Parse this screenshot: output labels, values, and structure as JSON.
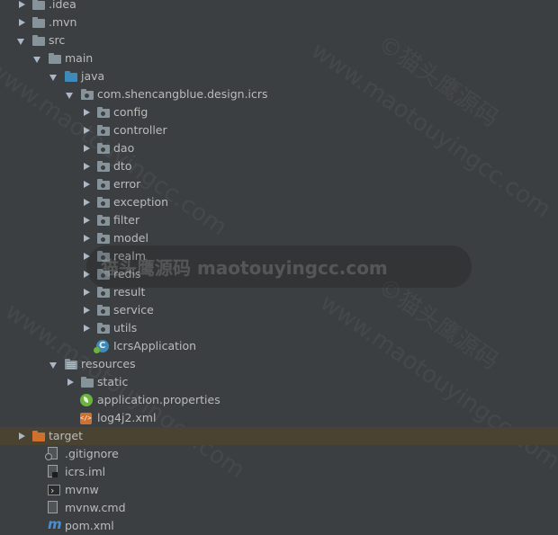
{
  "project_tree": {
    "items": [
      {
        "label": ".idea",
        "indent": 0,
        "arrow": "collapsed",
        "icon": "folder-gray",
        "icon_name": "folder-icon"
      },
      {
        "label": ".mvn",
        "indent": 0,
        "arrow": "collapsed",
        "icon": "folder-gray",
        "icon_name": "folder-icon"
      },
      {
        "label": "src",
        "indent": 0,
        "arrow": "expanded",
        "icon": "folder-gray",
        "icon_name": "folder-icon"
      },
      {
        "label": "main",
        "indent": 1,
        "arrow": "expanded",
        "icon": "folder-gray",
        "icon_name": "folder-icon"
      },
      {
        "label": "java",
        "indent": 2,
        "arrow": "expanded",
        "icon": "folder-blue",
        "icon_name": "source-folder-icon"
      },
      {
        "label": "com.shencangblue.design.icrs",
        "indent": 3,
        "arrow": "expanded",
        "icon": "package",
        "icon_name": "package-icon"
      },
      {
        "label": "config",
        "indent": 4,
        "arrow": "collapsed",
        "icon": "package",
        "icon_name": "package-icon"
      },
      {
        "label": "controller",
        "indent": 4,
        "arrow": "collapsed",
        "icon": "package",
        "icon_name": "package-icon"
      },
      {
        "label": "dao",
        "indent": 4,
        "arrow": "collapsed",
        "icon": "package",
        "icon_name": "package-icon"
      },
      {
        "label": "dto",
        "indent": 4,
        "arrow": "collapsed",
        "icon": "package",
        "icon_name": "package-icon"
      },
      {
        "label": "error",
        "indent": 4,
        "arrow": "collapsed",
        "icon": "package",
        "icon_name": "package-icon"
      },
      {
        "label": "exception",
        "indent": 4,
        "arrow": "collapsed",
        "icon": "package",
        "icon_name": "package-icon"
      },
      {
        "label": "filter",
        "indent": 4,
        "arrow": "collapsed",
        "icon": "package",
        "icon_name": "package-icon"
      },
      {
        "label": "model",
        "indent": 4,
        "arrow": "collapsed",
        "icon": "package",
        "icon_name": "package-icon"
      },
      {
        "label": "realm",
        "indent": 4,
        "arrow": "collapsed",
        "icon": "package",
        "icon_name": "package-icon"
      },
      {
        "label": "redis",
        "indent": 4,
        "arrow": "collapsed",
        "icon": "package",
        "icon_name": "package-icon"
      },
      {
        "label": "result",
        "indent": 4,
        "arrow": "collapsed",
        "icon": "package",
        "icon_name": "package-icon"
      },
      {
        "label": "service",
        "indent": 4,
        "arrow": "collapsed",
        "icon": "package",
        "icon_name": "package-icon"
      },
      {
        "label": "utils",
        "indent": 4,
        "arrow": "collapsed",
        "icon": "package",
        "icon_name": "package-icon"
      },
      {
        "label": "IcrsApplication",
        "indent": 4,
        "arrow": "none",
        "icon": "appclass",
        "icon_name": "spring-boot-class-icon"
      },
      {
        "label": "resources",
        "indent": 2,
        "arrow": "expanded",
        "icon": "resources",
        "icon_name": "resources-folder-icon"
      },
      {
        "label": "static",
        "indent": 3,
        "arrow": "collapsed",
        "icon": "folder-gray",
        "icon_name": "folder-icon"
      },
      {
        "label": "application.properties",
        "indent": 3,
        "arrow": "none",
        "icon": "spring",
        "icon_name": "spring-properties-icon"
      },
      {
        "label": "log4j2.xml",
        "indent": 3,
        "arrow": "none",
        "icon": "xml",
        "icon_name": "xml-file-icon"
      },
      {
        "label": "target",
        "indent": 0,
        "arrow": "collapsed",
        "icon": "folder-orange",
        "icon_name": "excluded-folder-icon",
        "selected": true
      },
      {
        "label": ".gitignore",
        "indent": 1,
        "arrow": "none",
        "icon": "git",
        "icon_name": "gitignore-file-icon"
      },
      {
        "label": "icrs.iml",
        "indent": 1,
        "arrow": "none",
        "icon": "iml",
        "icon_name": "module-file-icon"
      },
      {
        "label": "mvnw",
        "indent": 1,
        "arrow": "none",
        "icon": "term",
        "icon_name": "terminal-script-icon"
      },
      {
        "label": "mvnw.cmd",
        "indent": 1,
        "arrow": "none",
        "icon": "file",
        "icon_name": "text-file-icon"
      },
      {
        "label": "pom.xml",
        "indent": 1,
        "arrow": "none",
        "icon": "maven",
        "icon_name": "maven-icon"
      }
    ]
  },
  "watermark": {
    "band_text": "猫头鹰源码 maotouyingcc.com",
    "diagonal_text_1": "©猫头鹰源码",
    "diagonal_text_2": "www.maotouyingcc.com"
  },
  "colors": {
    "background": "#3c3f41",
    "text": "#bbbbbb",
    "folder": "#87939a",
    "source_folder": "#3d8bba",
    "excluded_folder": "#d0702f",
    "selection": "#4b4332"
  }
}
